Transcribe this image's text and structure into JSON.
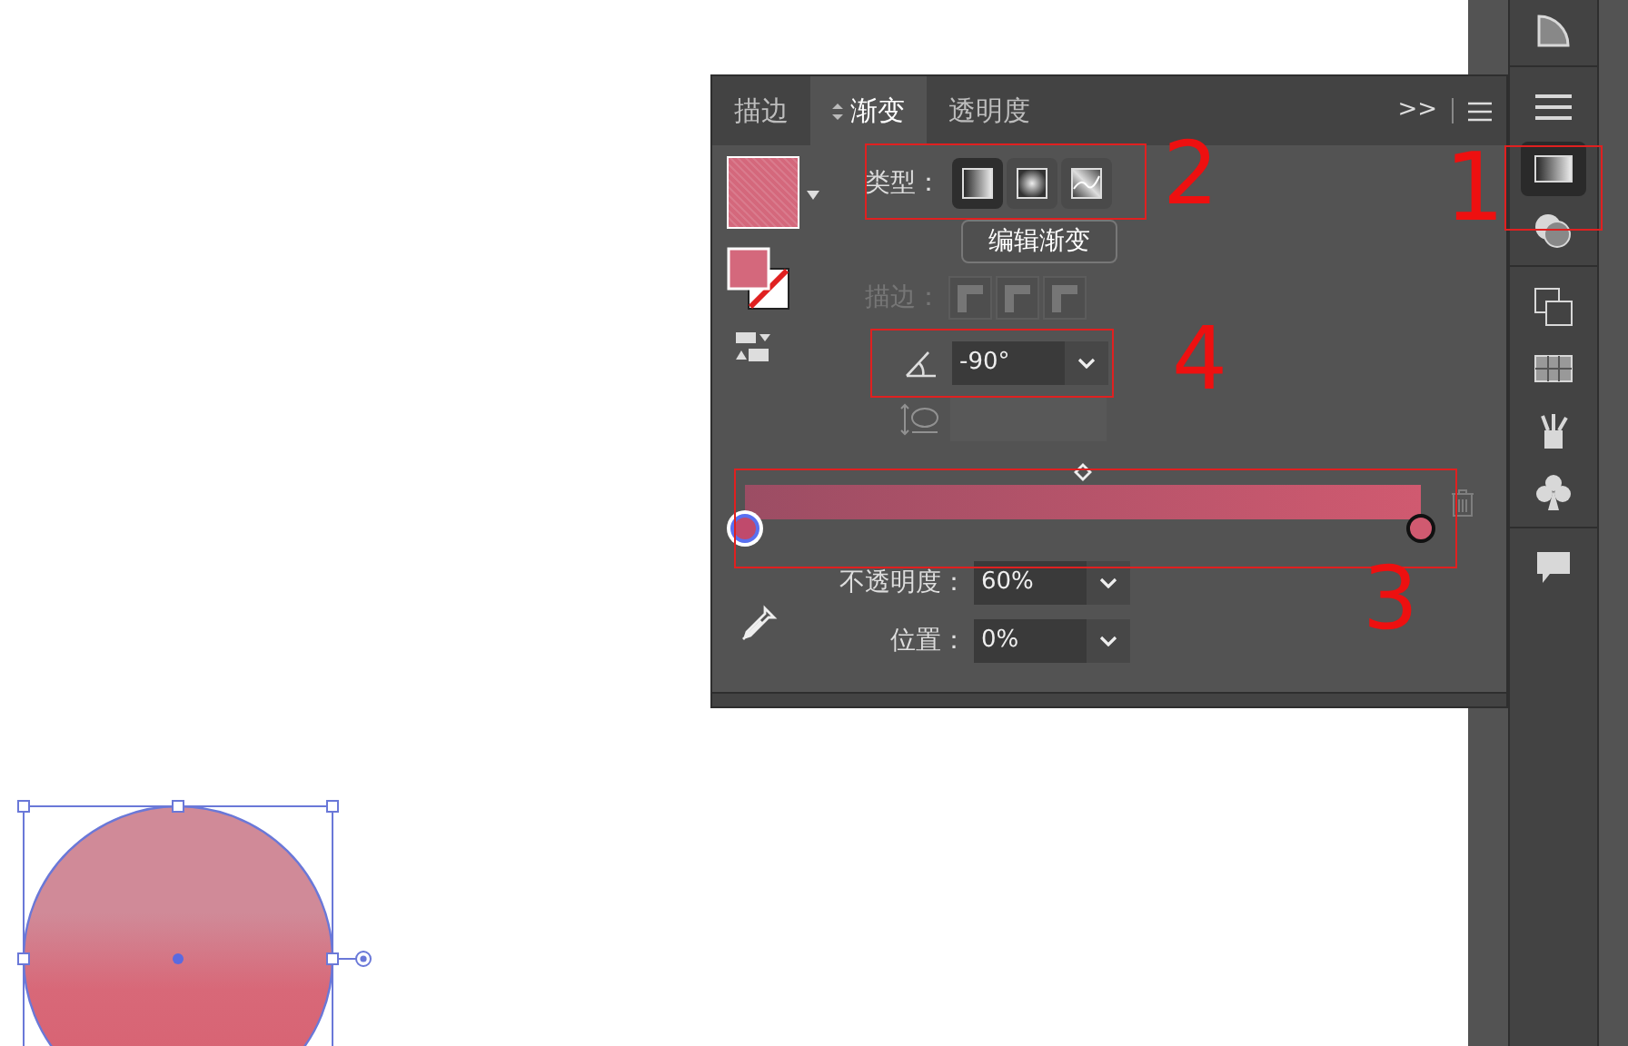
{
  "gradient_panel": {
    "tabs": [
      {
        "label": "描边",
        "selected": false
      },
      {
        "label": "渐变",
        "selected": true
      },
      {
        "label": "透明度",
        "selected": false
      }
    ],
    "overflow": ">>",
    "type_label": "类型：",
    "types": [
      {
        "kind": "linear",
        "selected": true
      },
      {
        "kind": "radial",
        "selected": false
      },
      {
        "kind": "freeform",
        "selected": false
      }
    ],
    "edit_button": "编辑渐变",
    "stroke_label": "描边：",
    "angle": "-90°",
    "opacity_label": "不透明度：",
    "opacity": "60%",
    "location_label": "位置：",
    "location": "0%",
    "stops": [
      {
        "color": "#c04a6c",
        "selected": true,
        "level": 0
      },
      {
        "color": "#d05a70",
        "selected": false,
        "level": 1
      }
    ],
    "midpoint": {
      "level": 0.5
    }
  },
  "dock": {
    "items": [
      {
        "kind": "corner",
        "selected": false
      },
      {
        "kind": "stroke",
        "selected": false
      },
      {
        "kind": "gradient",
        "selected": true
      },
      {
        "kind": "transparency",
        "selected": false
      },
      {
        "kind": "layers",
        "selected": false
      },
      {
        "kind": "swatches",
        "selected": false
      },
      {
        "kind": "brushes",
        "selected": false
      },
      {
        "kind": "symbols",
        "selected": false
      },
      {
        "kind": "comment",
        "selected": false
      }
    ]
  },
  "annotations": [
    {
      "label": "1"
    },
    {
      "label": "2"
    },
    {
      "label": "3"
    },
    {
      "label": "4"
    }
  ]
}
